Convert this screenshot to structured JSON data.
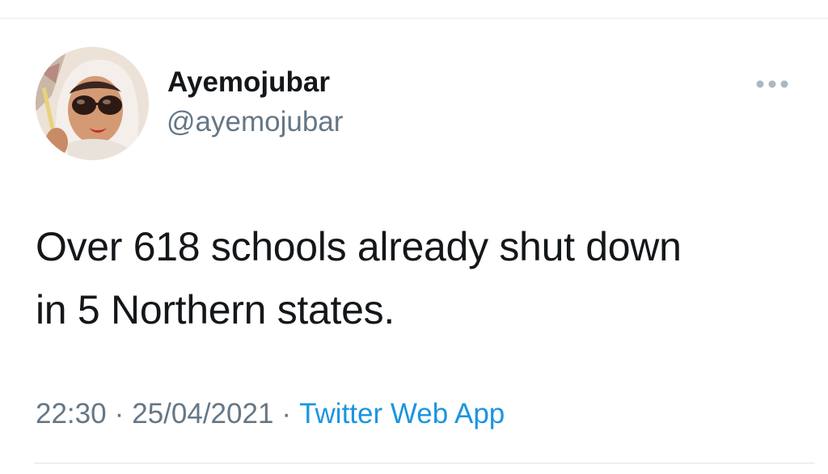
{
  "tweet": {
    "author": {
      "display_name": "Ayemojubar",
      "handle": "@ayemojubar",
      "avatar_icon": "profile-photo"
    },
    "more_icon": "ellipsis-icon",
    "text_line1": "Over 618 schools already shut down",
    "text_line2": "in 5 Northern states.",
    "time": "22:30",
    "separator": "·",
    "date": "25/04/2021",
    "source": "Twitter Web App"
  },
  "colors": {
    "text_primary": "#14171a",
    "text_secondary": "#657786",
    "link": "#1b95e0",
    "divider": "#e6ecf0"
  }
}
